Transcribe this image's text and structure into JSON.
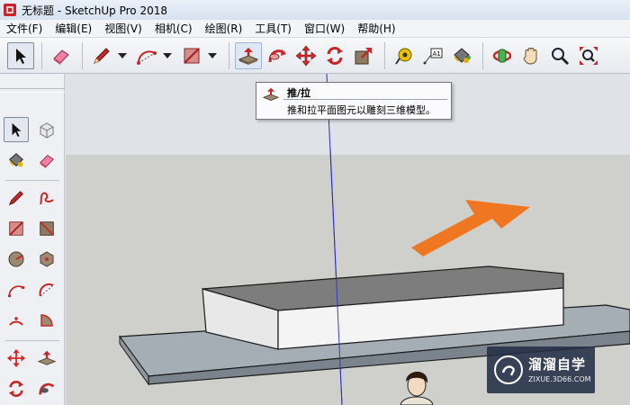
{
  "window": {
    "title": "无标题 - SketchUp Pro 2018"
  },
  "menu": [
    "文件(F)",
    "编辑(E)",
    "视图(V)",
    "相机(C)",
    "绘图(R)",
    "工具(T)",
    "窗口(W)",
    "帮助(H)"
  ],
  "toolbar": {
    "tools": [
      "select-tool",
      "eraser-tool",
      "pencil-tool",
      "arc-tool",
      "rectangle-tool",
      "push-pull-tool",
      "follow-me-tool",
      "move-tool",
      "rotate-tool",
      "scale-tool",
      "tape-measure-tool",
      "text-tool",
      "paint-bucket-tool",
      "orbit-tool",
      "pan-tool",
      "zoom-tool",
      "zoom-extents-tool"
    ],
    "active": "select-tool",
    "highlighted": "push-pull-tool"
  },
  "tooltip": {
    "title": "推/拉",
    "description": "推和拉平面图元以雕刻三维模型。"
  },
  "watermark": {
    "name": "溜溜自学",
    "url": "ZIXUE.3D66.COM"
  },
  "colors": {
    "annotation_arrow": "#f07722",
    "ground": "#cfd0cb",
    "sky": "#dfe3e8",
    "blue_axis": "#2d2dc8"
  }
}
